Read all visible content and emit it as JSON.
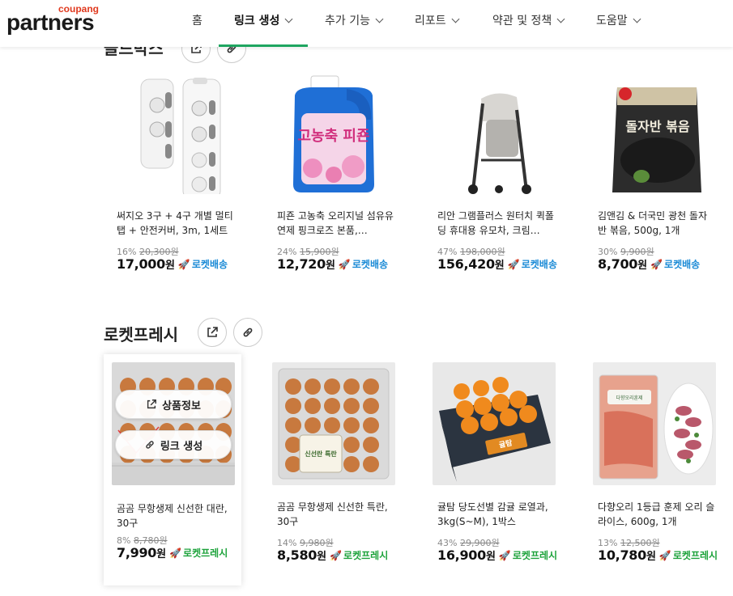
{
  "header": {
    "logo_top": "coupang",
    "logo_main": "partners",
    "nav": [
      {
        "label": "홈"
      },
      {
        "label": "링크 생성"
      },
      {
        "label": "추가 기능"
      },
      {
        "label": "리포트"
      },
      {
        "label": "약관 및 정책"
      },
      {
        "label": "도움말"
      }
    ]
  },
  "section_top": {
    "title": "골드박스"
  },
  "section_fresh": {
    "title": "로켓프레시"
  },
  "overlay": {
    "info_label": "상품정보",
    "link_label": "링크 생성"
  },
  "products_top": [
    {
      "name": "써지오 3구 + 4구 개별 멀티탭 + 안전커버, 3m, 1세트",
      "discount": "16%",
      "original": "20,300원",
      "price": "17,000",
      "won": "원",
      "badge": "로켓배송"
    },
    {
      "name": "피죤 고농축 오리지널 섬유유연제 핑크로즈 본품,…",
      "discount": "24%",
      "original": "15,900원",
      "price": "12,720",
      "won": "원",
      "badge": "로켓배송"
    },
    {
      "name": "리안 그램플러스 원터치 퀵폴딩 휴대용 유모차, 크림…",
      "discount": "47%",
      "original": "198,000원",
      "price": "156,420",
      "won": "원",
      "badge": "로켓배송"
    },
    {
      "name": "김앤김 & 더국민 광천 돌자반 볶음, 500g, 1개",
      "discount": "30%",
      "original": "9,900원",
      "price": "8,700",
      "won": "원",
      "badge": "로켓배송"
    }
  ],
  "products_fresh": [
    {
      "name": "곰곰 무항생제 신선한 대란, 30구",
      "discount": "8%",
      "original": "8,780원",
      "price": "7,990",
      "won": "원",
      "badge": "로켓프레시"
    },
    {
      "name": "곰곰 무항생제 신선한 특란, 30구",
      "discount": "14%",
      "original": "9,980원",
      "price": "8,580",
      "won": "원",
      "badge": "로켓프레시"
    },
    {
      "name": "귤탐 당도선별 감귤 로열과, 3kg(S~M), 1박스",
      "discount": "43%",
      "original": "29,900원",
      "price": "16,900",
      "won": "원",
      "badge": "로켓프레시"
    },
    {
      "name": "다향오리 1등급 훈제 오리 슬라이스, 600g, 1개",
      "discount": "13%",
      "original": "12,500원",
      "price": "10,780",
      "won": "원",
      "badge": "로켓프레시"
    }
  ],
  "image_labels": {
    "fabric": "고농축 피죤",
    "seaweed": "돌자반 볶음",
    "tangerine_box": "귤탐",
    "egg_label": "신선란 특란",
    "duck_label": "다향오리훈제"
  },
  "colors": {
    "accent_green": "#1ea560",
    "rocket_blue": "#1a8ad6",
    "fresh_green": "#1ea33c",
    "logo_red": "#e0391e"
  },
  "icons": [
    "external-link-icon",
    "link-icon",
    "chevron-down-icon",
    "rocket-icon"
  ]
}
